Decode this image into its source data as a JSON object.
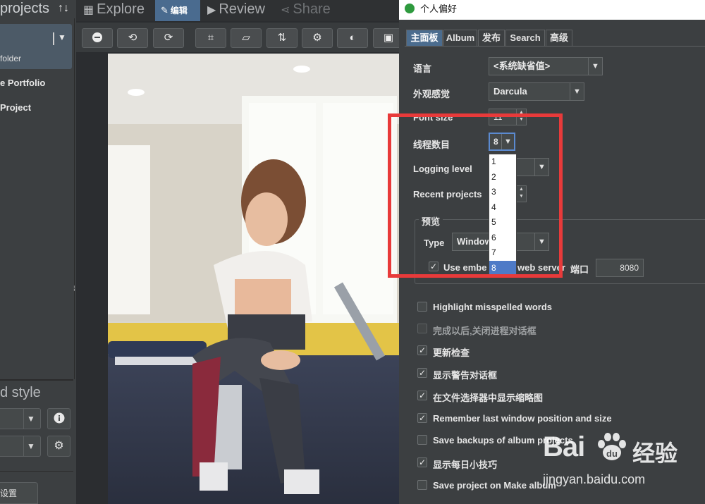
{
  "left": {
    "title": "projects",
    "sort_icon": "↑↓",
    "folder_label": "folder",
    "items": [
      "e Portfolio",
      "Project"
    ],
    "style_title": "d style",
    "settings_label": "设置"
  },
  "topbar": {
    "explore": "Explore",
    "edit": "编辑",
    "review": "Review",
    "share": "Share"
  },
  "toolbar": {
    "buttons": [
      "remove-icon",
      "rotate-left-icon",
      "rotate-right-icon",
      "crop-icon",
      "straighten-icon",
      "flip-icon",
      "settings-icon",
      "contrast-icon",
      "image-icon"
    ]
  },
  "dialog": {
    "title": "个人偏好",
    "tabs": [
      "主面板",
      "Album",
      "发布",
      "Search",
      "高级"
    ],
    "active_tab": "主面板",
    "fields": {
      "language_label": "语言",
      "language_value": "<系统缺省值>",
      "laf_label": "外观感觉",
      "laf_value": "Darcula",
      "font_size_label": "Font size",
      "font_size_value": "11",
      "threads_label": "线程数目",
      "threads_value": "8",
      "logging_label": "Logging level",
      "recent_label": "Recent projects"
    },
    "thread_options": [
      "1",
      "2",
      "3",
      "4",
      "5",
      "6",
      "7",
      "8"
    ],
    "selected_thread_index": 7,
    "preview": {
      "group_title": "预览",
      "type_label": "Type",
      "type_value": "Window",
      "embedded_label_a": "Use embe",
      "embedded_label_b": "web server",
      "embedded_checked": true,
      "port_label": "端口",
      "port_value": "8080"
    },
    "checkboxes": [
      {
        "label": "Highlight misspelled words",
        "checked": false,
        "enabled": true
      },
      {
        "label": "完成以后,关闭进程对话框",
        "checked": false,
        "enabled": false
      },
      {
        "label": "更新检查",
        "checked": true,
        "enabled": true
      },
      {
        "label": "显示警告对话框",
        "checked": true,
        "enabled": true
      },
      {
        "label": "在文件选择器中显示缩略图",
        "checked": true,
        "enabled": true
      },
      {
        "label": "Remember last window position and size",
        "checked": true,
        "enabled": true
      },
      {
        "label": "Save backups of album projects",
        "checked": false,
        "enabled": true
      },
      {
        "label": "显示每日小技巧",
        "checked": true,
        "enabled": true
      },
      {
        "label": "Save project on Make album",
        "checked": false,
        "enabled": true
      }
    ]
  },
  "watermark": {
    "brand": "Bai",
    "brand_cn": "经验",
    "url": "jingyan.baidu.com"
  },
  "colors": {
    "accent": "#4b6c8e",
    "annotation": "#e83a3a",
    "selection": "#4e7ac7"
  }
}
